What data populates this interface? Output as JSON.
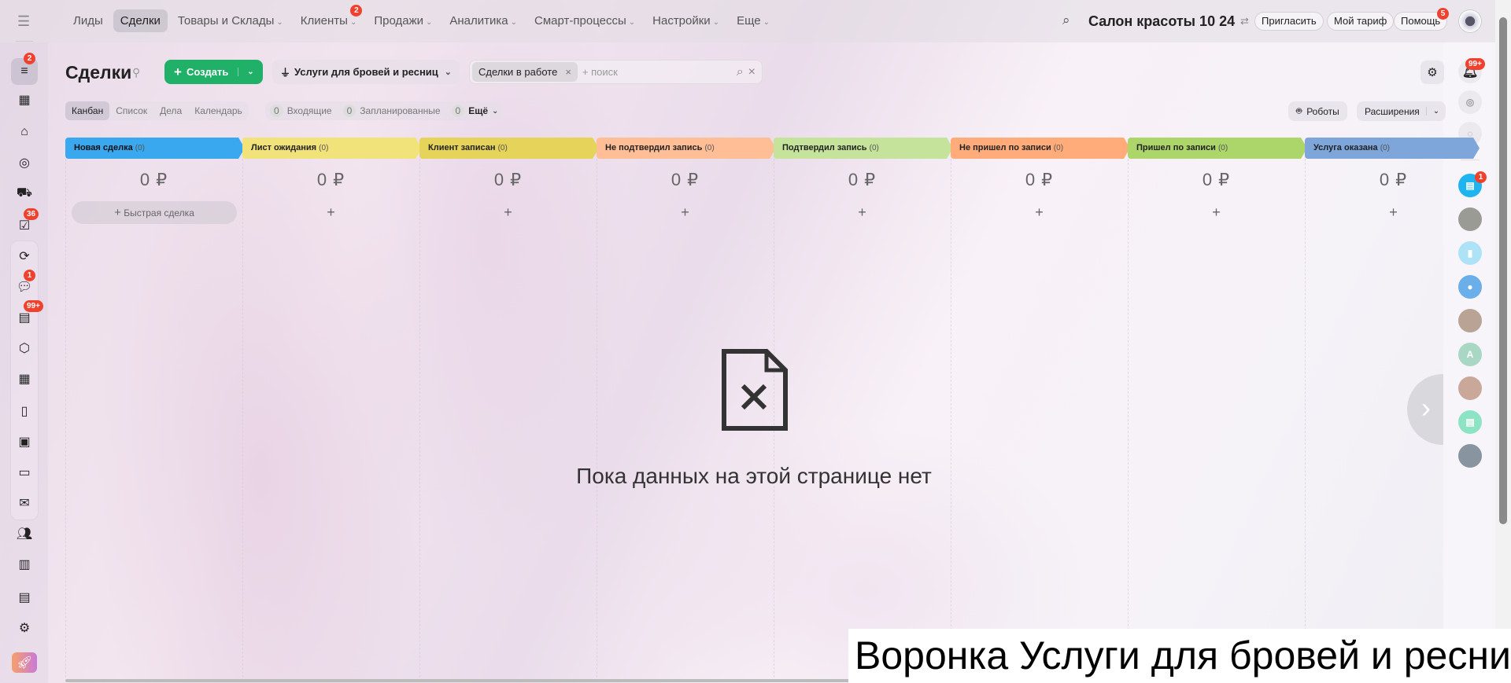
{
  "topnav": {
    "items": [
      {
        "label": "Лиды"
      },
      {
        "label": "Сделки",
        "active": true
      },
      {
        "label": "Товары и Склады",
        "chev": true
      },
      {
        "label": "Клиенты",
        "chev": true,
        "badge": "2"
      },
      {
        "label": "Продажи",
        "chev": true
      },
      {
        "label": "Аналитика",
        "chev": true
      },
      {
        "label": "Смарт-процессы",
        "chev": true
      },
      {
        "label": "Настройки",
        "chev": true
      },
      {
        "label": "Еще",
        "chev": true
      }
    ],
    "company": "Салон красоты 10 24",
    "invite": "Пригласить",
    "tariff": "Мой тариф",
    "help": "Помощь",
    "help_badge": "5"
  },
  "left_sidebar": {
    "badges": {
      "crm": "2",
      "tasks": "36",
      "chat": "1",
      "feed": "99+"
    }
  },
  "header": {
    "title": "Сделки",
    "create": "Создать",
    "funnel": "Услуги для бровей и ресниц",
    "filter_chip": "Сделки в работе",
    "search_placeholder": "+ поиск"
  },
  "views": {
    "tabs": [
      "Канбан",
      "Список",
      "Дела",
      "Календарь"
    ],
    "counters": [
      {
        "count": "0",
        "label": "Входящие"
      },
      {
        "count": "0",
        "label": "Запланированные"
      },
      {
        "count": "0",
        "label": "Ещё"
      }
    ],
    "robots": "Роботы",
    "extensions": "Расширения"
  },
  "notifications_badge": "99+",
  "chat_badge": "1",
  "avatar_letter": "A",
  "columns": [
    {
      "title": "Новая сделка",
      "count": "(0)",
      "sum": "0 ₽",
      "color": "#39a8ef",
      "quick": "Быстрая сделка"
    },
    {
      "title": "Лист ожидания",
      "count": "(0)",
      "sum": "0 ₽",
      "color": "#f1e27a"
    },
    {
      "title": "Клиент записан",
      "count": "(0)",
      "sum": "0 ₽",
      "color": "#e5d35a"
    },
    {
      "title": "Не подтвердил запись",
      "count": "(0)",
      "sum": "0 ₽",
      "color": "#ffbe95"
    },
    {
      "title": "Подтвердил запись",
      "count": "(0)",
      "sum": "0 ₽",
      "color": "#c5e39a"
    },
    {
      "title": "Не пришел по записи",
      "count": "(0)",
      "sum": "0 ₽",
      "color": "#ffab7a"
    },
    {
      "title": "Пришел по записи",
      "count": "(0)",
      "sum": "0 ₽",
      "color": "#acd56a"
    },
    {
      "title": "Услуга оказана",
      "count": "(0)",
      "sum": "0 ₽",
      "color": "#7ea6da"
    }
  ],
  "plus": "+",
  "empty": {
    "text": "Пока данных на этой странице нет"
  },
  "caption": "Воронка Услуги для бровей и ресниц"
}
